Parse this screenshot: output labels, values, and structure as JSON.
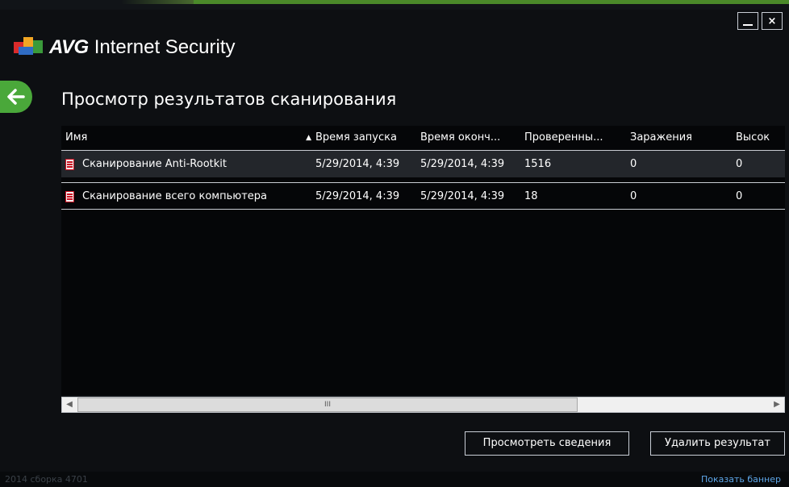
{
  "window": {
    "brand": "AVG",
    "product": "Internet Security",
    "minimize_label": "_",
    "close_label": "×"
  },
  "page": {
    "title": "Просмотр результатов сканирования"
  },
  "table": {
    "columns": [
      "Имя",
      "Время запуска",
      "Время оконч...",
      "Проверенны...",
      "Заражения",
      "Высок"
    ],
    "sorted_column": "Имя",
    "sort_direction": "ascending",
    "rows": [
      {
        "name": "Сканирование Anti-Rootkit",
        "start": "5/29/2014, 4:39",
        "end": "5/29/2014, 4:39",
        "scanned": "1516",
        "infections": "0",
        "high": "0",
        "selected": true
      },
      {
        "name": "Сканирование всего компьютера",
        "start": "5/29/2014, 4:39",
        "end": "5/29/2014, 4:39",
        "scanned": "18",
        "infections": "0",
        "high": "0",
        "selected": false
      }
    ]
  },
  "scrollbar": {
    "thumb_grip": "III"
  },
  "buttons": {
    "details": "Просмотреть сведения",
    "delete": "Удалить результат"
  },
  "footer": {
    "build": "2014  сборка 4701",
    "banner_link": "Показать баннер"
  },
  "colors": {
    "accent_green": "#4aa83a",
    "link_blue": "#5ea6e8",
    "background": "#0d0f12"
  },
  "icons": [
    "avg-logo-icon",
    "back-arrow-icon",
    "document-icon",
    "sort-ascending-icon"
  ]
}
